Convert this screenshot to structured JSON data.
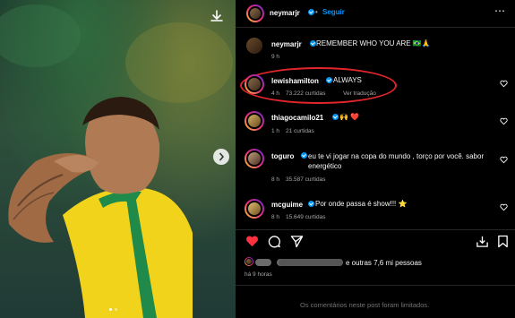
{
  "post": {
    "author": "neymarjr",
    "follow_label": "Seguir",
    "caption_author": "neymarjr",
    "caption_text": "REMEMBER WHO YOU ARE 🇧🇷🙏",
    "caption_time": "9 h"
  },
  "comments": [
    {
      "user": "lewishamilton",
      "text": "ALWAYS",
      "time": "4 h",
      "likes": "73.222 curtidas",
      "translate": "Ver tradução"
    },
    {
      "user": "thiagocamilo21",
      "text": "🙌 ❤️",
      "time": "1 h",
      "likes": "21 curtidas"
    },
    {
      "user": "toguro",
      "text": "eu te vi jogar na copa do mundo , torço por você. sabor energético",
      "time": "8 h",
      "likes": "35.587 curtidas"
    },
    {
      "user": "mcguime",
      "text": "Por onde passa é show!!! ⭐",
      "time": "8 h",
      "likes": "15.649 curtidas"
    }
  ],
  "likes_summary": "e outras 7,6 mi pessoas",
  "post_time": "há 9 horas",
  "comments_limited": "Os comentários neste post foram limitados.",
  "colors": {
    "accent": "#0095f6",
    "like_red": "#ff3040",
    "circle": "#e0262c"
  }
}
